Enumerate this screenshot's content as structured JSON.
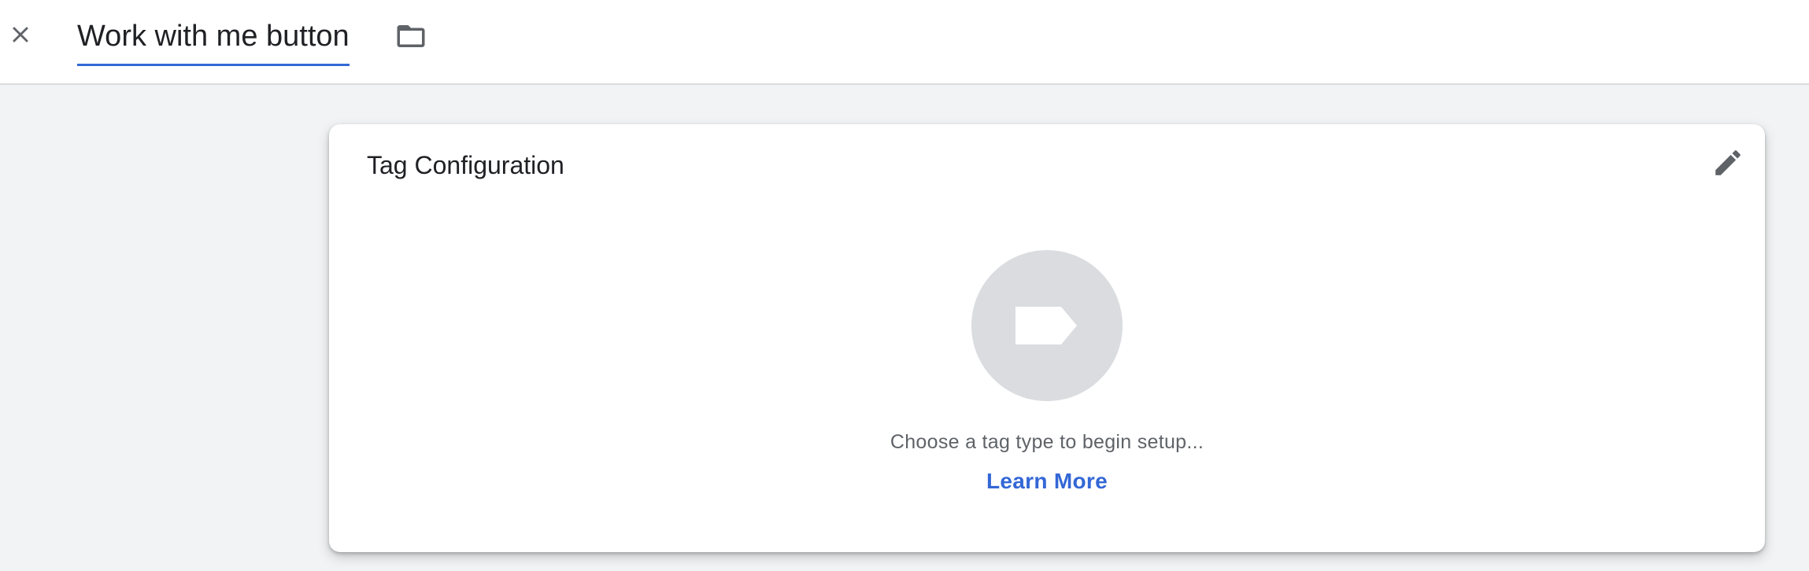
{
  "header": {
    "close_icon": "close-icon",
    "title": "Work with me button",
    "folder_icon": "folder-icon",
    "accent_color": "#3367d6"
  },
  "card": {
    "title": "Tag Configuration",
    "edit_icon": "pencil-icon",
    "tag_icon": "tag-icon",
    "hint": "Choose a tag type to begin setup...",
    "learn_more": "Learn More"
  }
}
